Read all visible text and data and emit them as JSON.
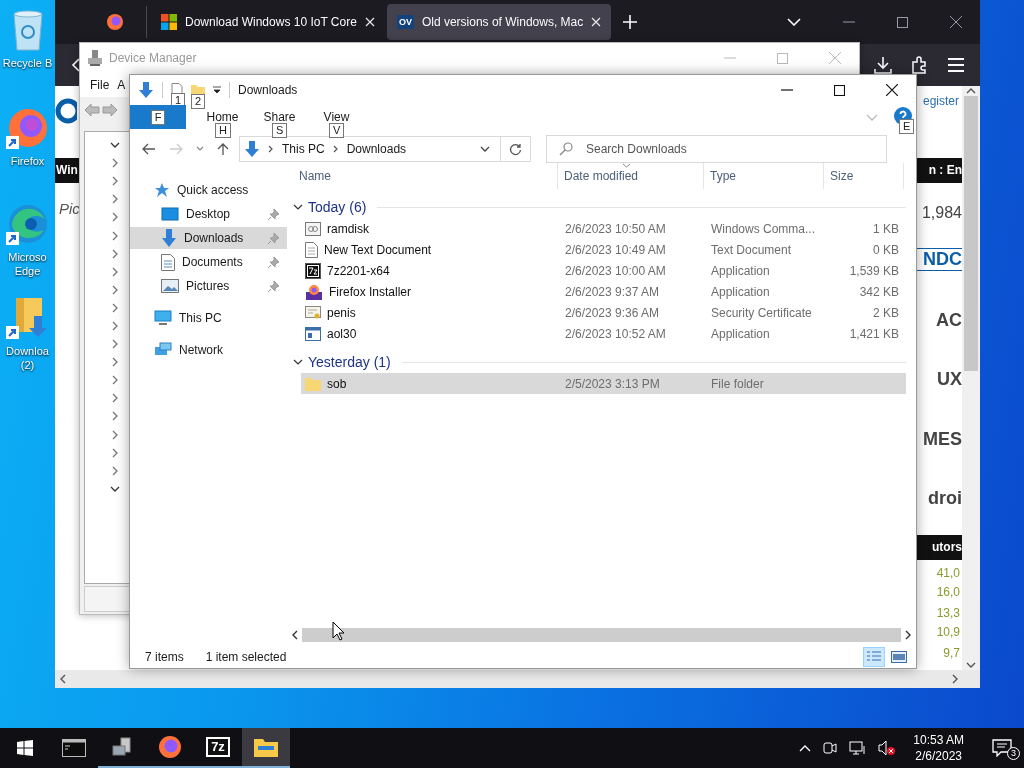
{
  "desktop_icons": [
    {
      "label": "Recycle B",
      "kind": "recycle",
      "shortcut": false
    },
    {
      "label": "Firefox",
      "kind": "firefox",
      "shortcut": true
    },
    {
      "label": "Microso Edge",
      "kind": "edge",
      "shortcut": true
    },
    {
      "label": "Downloa (2)",
      "kind": "downloads",
      "shortcut": true
    }
  ],
  "browser": {
    "tabs": [
      {
        "title": "Download Windows 10 IoT Core",
        "kind": "windows",
        "selected": false
      },
      {
        "title": "Old versions of Windows, Mac",
        "kind": "badge",
        "badge": "OV",
        "selected": true
      }
    ],
    "left_fragments": [
      {
        "kind": "logo"
      },
      {
        "kind": "bar",
        "text": "Win"
      },
      {
        "kind": "italic",
        "text": "Pic"
      }
    ],
    "right_fragments": [
      {
        "kind": "link",
        "text": "egister"
      },
      {
        "kind": "bar",
        "text": "n  :  En"
      },
      {
        "kind": "plain",
        "text": "1,984"
      },
      {
        "kind": "brand",
        "text": "NDC"
      },
      {
        "kind": "heading",
        "text": "AC"
      },
      {
        "kind": "heading",
        "text": "UX"
      },
      {
        "kind": "heading",
        "text": "MES"
      },
      {
        "kind": "heading",
        "text": "droi"
      },
      {
        "kind": "bar",
        "text": "utors"
      },
      {
        "kind": "number",
        "text": "41,0"
      },
      {
        "kind": "number",
        "text": "16,0"
      },
      {
        "kind": "number",
        "text": "13,3"
      },
      {
        "kind": "number",
        "text": "10,9"
      },
      {
        "kind": "number",
        "text": "9,7"
      }
    ]
  },
  "device_manager": {
    "title": "Device Manager",
    "menu": [
      "File",
      "A"
    ],
    "tree": [
      {
        "expanded": true
      },
      {
        "expanded": false
      },
      {
        "expanded": false
      },
      {
        "expanded": false
      },
      {
        "expanded": false
      },
      {
        "expanded": false
      },
      {
        "expanded": false
      },
      {
        "expanded": false
      },
      {
        "expanded": false
      },
      {
        "expanded": false
      },
      {
        "expanded": false
      },
      {
        "expanded": false
      },
      {
        "expanded": false
      },
      {
        "expanded": false
      },
      {
        "expanded": false
      },
      {
        "expanded": false
      },
      {
        "expanded": false
      },
      {
        "expanded": false
      },
      {
        "expanded": false
      },
      {
        "expanded": true
      }
    ]
  },
  "explorer": {
    "title": "Downloads",
    "quick_access_keys": [
      "1",
      "2"
    ],
    "file_tab": {
      "key": "F"
    },
    "ribbon_tabs": [
      {
        "label": "Home",
        "key": "H"
      },
      {
        "label": "Share",
        "key": "S"
      },
      {
        "label": "View",
        "key": "V"
      }
    ],
    "help_key": "E",
    "address": [
      "This PC",
      "Downloads"
    ],
    "search": {
      "placeholder": "Search Downloads"
    },
    "nav": [
      {
        "label": "Quick access",
        "kind": "star",
        "selected": false,
        "children": [
          {
            "label": "Desktop",
            "kind": "desktop",
            "selected": false,
            "pinned": true
          },
          {
            "label": "Downloads",
            "kind": "download",
            "selected": true,
            "pinned": true
          },
          {
            "label": "Documents",
            "kind": "document",
            "selected": false,
            "pinned": true
          },
          {
            "label": "Pictures",
            "kind": "pictures",
            "selected": false,
            "pinned": true
          }
        ]
      },
      {
        "label": "This PC",
        "kind": "pc",
        "selected": false
      },
      {
        "label": "Network",
        "kind": "network",
        "selected": false
      }
    ],
    "columns": [
      "Name",
      "Date modified",
      "Type",
      "Size"
    ],
    "groups": [
      {
        "title": "Today (6)",
        "expanded": true,
        "files": [
          {
            "name": "ramdisk",
            "date": "2/6/2023 10:50 AM",
            "type": "Windows Comma...",
            "size": "1 KB",
            "kind": "script",
            "selected": false
          },
          {
            "name": "New Text Document",
            "date": "2/6/2023 10:49 AM",
            "type": "Text Document",
            "size": "0 KB",
            "kind": "text",
            "selected": false
          },
          {
            "name": "7z2201-x64",
            "date": "2/6/2023 10:00 AM",
            "type": "Application",
            "size": "1,539 KB",
            "kind": "archiver",
            "selected": false
          },
          {
            "name": "Firefox Installer",
            "date": "2/6/2023 9:37 AM",
            "type": "Application",
            "size": "342 KB",
            "kind": "installer",
            "selected": false
          },
          {
            "name": "penis",
            "date": "2/6/2023 9:36 AM",
            "type": "Security Certificate",
            "size": "2 KB",
            "kind": "certificate",
            "selected": false
          },
          {
            "name": "aol30",
            "date": "2/6/2023 10:52 AM",
            "type": "Application",
            "size": "1,421 KB",
            "kind": "app",
            "selected": false
          }
        ]
      },
      {
        "title": "Yesterday (1)",
        "expanded": true,
        "files": [
          {
            "name": "sob",
            "date": "2/5/2023 3:13 PM",
            "type": "File folder",
            "kind": "folder",
            "selected": true
          }
        ]
      }
    ],
    "status": {
      "items": "7 items",
      "selection": "1 item selected"
    },
    "views": [
      {
        "kind": "details",
        "selected": true
      },
      {
        "kind": "tiles",
        "selected": false
      }
    ]
  },
  "taskbar": {
    "apps": [
      {
        "kind": "terminal",
        "running": false,
        "selected": false
      },
      {
        "kind": "server",
        "running": true,
        "selected": false
      },
      {
        "kind": "firefox",
        "running": true,
        "selected": false
      },
      {
        "kind": "archiver",
        "glyph": "7z",
        "running": true,
        "selected": false
      },
      {
        "kind": "explorer",
        "running": true,
        "selected": true
      }
    ],
    "time": "10:53 AM",
    "date": "2/6/2023",
    "notifications": "3"
  }
}
